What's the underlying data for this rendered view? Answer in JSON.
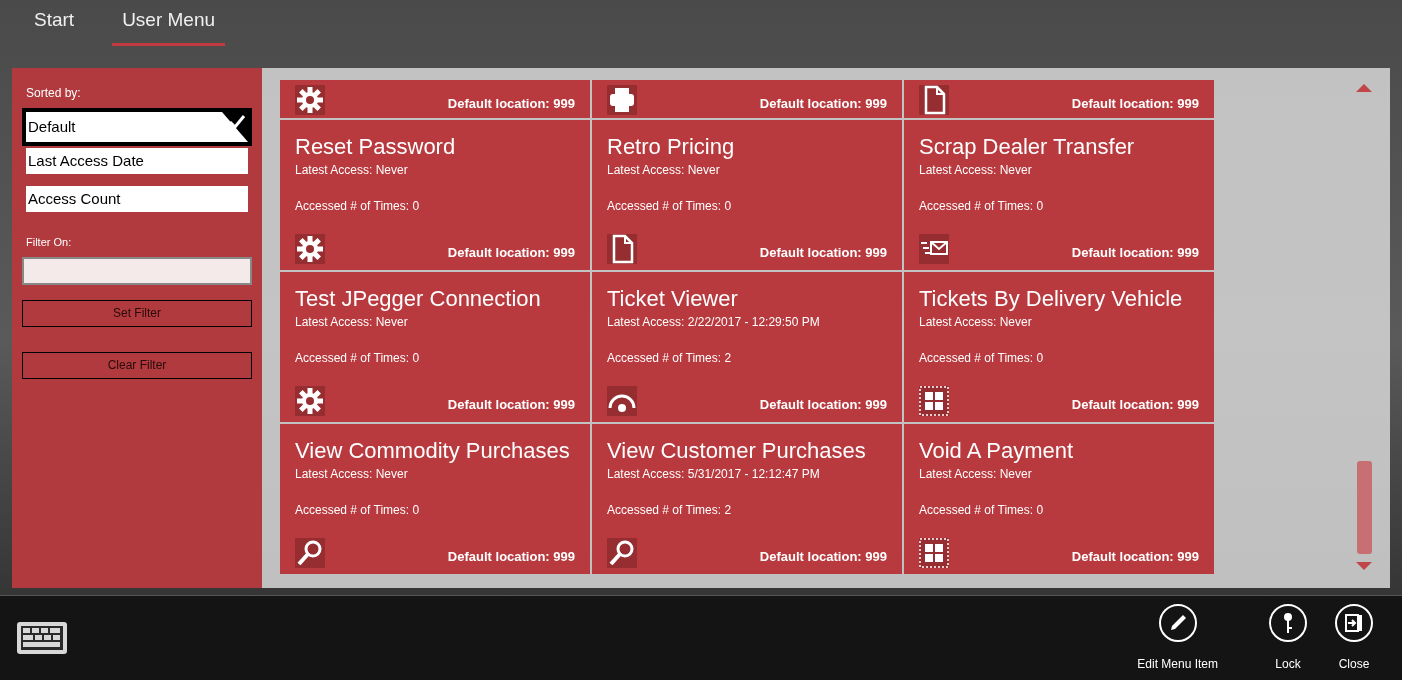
{
  "tabs": [
    {
      "label": "Start",
      "selected": false
    },
    {
      "label": "User Menu",
      "selected": true
    }
  ],
  "sort_panel": {
    "label": "Sorted by:",
    "options": [
      {
        "label": "Default",
        "selected": true
      },
      {
        "label": "Last Access Date",
        "selected": false
      },
      {
        "label": "Access Count",
        "selected": false
      }
    ],
    "filter_label": "Filter On:",
    "buttons": [
      "Set Filter",
      "Clear Filter"
    ]
  },
  "partial_tiles": [
    {
      "kind": "gear",
      "location": "Default location: 999"
    },
    {
      "kind": "printer",
      "location": "Default location: 999"
    },
    {
      "kind": "document",
      "location": "Default location: 999"
    }
  ],
  "tiles": [
    {
      "title": "Reset Password",
      "latest": "Latest Access: Never",
      "count": "Accessed # of Times: 0",
      "kind": "gear",
      "location": "Default location: 999"
    },
    {
      "title": "Retro Pricing",
      "latest": "Latest Access: Never",
      "count": "Accessed # of Times: 0",
      "kind": "document",
      "location": "Default location: 999"
    },
    {
      "title": "Scrap Dealer Transfer",
      "latest": "Latest Access: Never",
      "count": "Accessed # of Times: 0",
      "kind": "mail",
      "location": "Default location: 999"
    },
    {
      "title": "Test JPegger Connection",
      "latest": "Latest Access: Never",
      "count": "Accessed # of Times: 0",
      "kind": "gear",
      "location": "Default location: 999"
    },
    {
      "title": "Ticket Viewer",
      "latest": "Latest Access: 2/22/2017 - 12:29:50 PM",
      "count": "Accessed # of Times: 2",
      "kind": "gauge",
      "location": "Default location: 999"
    },
    {
      "title": "Tickets By Delivery Vehicle",
      "latest": "Latest Access: Never",
      "count": "Accessed # of Times: 0",
      "kind": "grid",
      "location": "Default location: 999"
    },
    {
      "title": "View Commodity Purchases",
      "latest": "Latest Access: Never",
      "count": "Accessed # of Times: 0",
      "kind": "search",
      "location": "Default location: 999"
    },
    {
      "title": "View Customer Purchases",
      "latest": "Latest Access: 5/31/2017 - 12:12:47 PM",
      "count": "Accessed # of Times: 2",
      "kind": "search",
      "location": "Default location: 999"
    },
    {
      "title": "Void A Payment",
      "latest": "Latest Access: Never",
      "count": "Accessed # of Times: 0",
      "kind": "grid",
      "location": "Default location: 999"
    }
  ],
  "app_bar": [
    {
      "kind": "pencil",
      "label": "Edit Menu Item"
    },
    {
      "kind": "key",
      "label": "Lock"
    },
    {
      "kind": "exit",
      "label": "Close"
    }
  ]
}
